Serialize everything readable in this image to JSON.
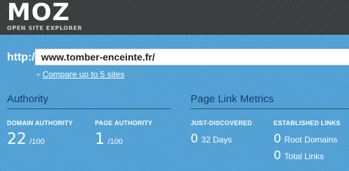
{
  "brand": {
    "logo_text": "MOZ",
    "subtitle": "OPEN SITE EXPLORER"
  },
  "search": {
    "prefix": "http://",
    "url_value": "www.tomber-enceinte.fr/",
    "compare_icon": "+",
    "compare_label": "Compare up to 5 sites"
  },
  "authority": {
    "title": "Authority",
    "domain_authority": {
      "label": "DOMAIN AUTHORITY",
      "value": "22",
      "suffix": "/100"
    },
    "page_authority": {
      "label": "PAGE AUTHORITY",
      "value": "1",
      "suffix": "/100"
    }
  },
  "page_link_metrics": {
    "title": "Page Link Metrics",
    "just_discovered": {
      "label": "JUST-DISCOVERED",
      "value": "0",
      "suffix": "32 Days"
    },
    "established_links": {
      "label": "ESTABLISHED LINKS",
      "root_domains": {
        "value": "0",
        "suffix": "Root Domains"
      },
      "total_links": {
        "value": "0",
        "suffix": "Total Links"
      }
    }
  },
  "colors": {
    "topbar": "#3a3b3d",
    "background": "#4f9fd4",
    "section_title": "#123e66"
  }
}
